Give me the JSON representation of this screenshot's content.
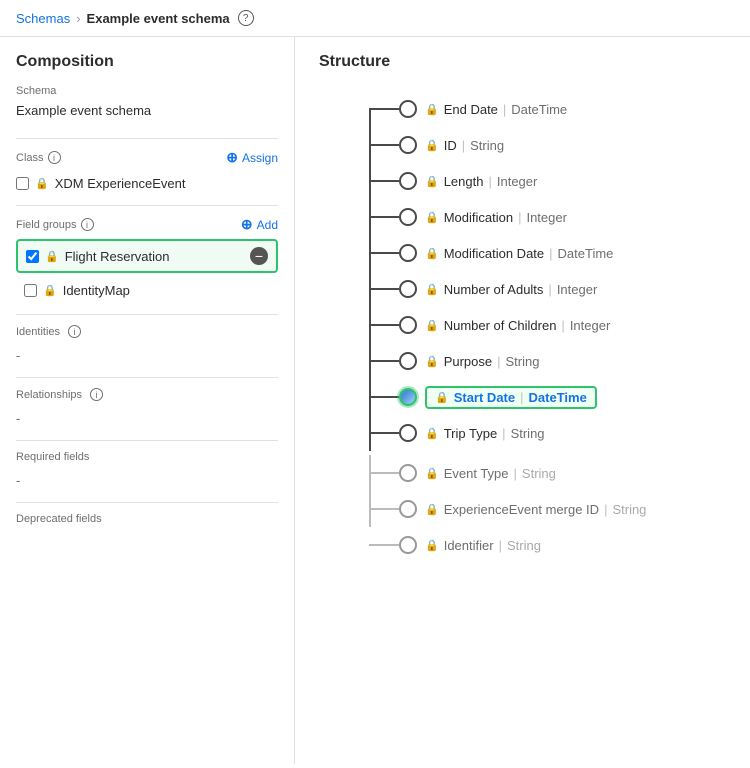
{
  "topbar": {
    "schemas_label": "Schemas",
    "separator": "›",
    "current_page": "Example event schema",
    "help_label": "?"
  },
  "left_panel": {
    "composition_title": "Composition",
    "schema_label": "Schema",
    "schema_value": "Example event schema",
    "class_label": "Class",
    "class_help": "i",
    "assign_label": "Assign",
    "class_item": "XDM ExperienceEvent",
    "field_groups_label": "Field groups",
    "field_groups_help": "i",
    "add_label": "Add",
    "field_groups": [
      {
        "name": "Flight Reservation",
        "highlighted": true
      },
      {
        "name": "IdentityMap",
        "highlighted": false
      }
    ],
    "identities_label": "Identities",
    "identities_help": "i",
    "identities_value": "-",
    "relationships_label": "Relationships",
    "relationships_help": "i",
    "relationships_value": "-",
    "required_fields_label": "Required fields",
    "required_fields_value": "-",
    "deprecated_fields_label": "Deprecated fields"
  },
  "right_panel": {
    "structure_title": "Structure",
    "nodes": [
      {
        "name": "End Date",
        "type": "DateTime",
        "highlighted": false
      },
      {
        "name": "ID",
        "type": "String",
        "highlighted": false
      },
      {
        "name": "Length",
        "type": "Integer",
        "highlighted": false
      },
      {
        "name": "Modification",
        "type": "Integer",
        "highlighted": false
      },
      {
        "name": "Modification Date",
        "type": "DateTime",
        "highlighted": false
      },
      {
        "name": "Number of Adults",
        "type": "Integer",
        "highlighted": false
      },
      {
        "name": "Number of Children",
        "type": "Integer",
        "highlighted": false
      },
      {
        "name": "Purpose",
        "type": "String",
        "highlighted": false
      },
      {
        "name": "Start Date",
        "type": "DateTime",
        "highlighted": true,
        "blue_circle": true
      },
      {
        "name": "Trip Type",
        "type": "String",
        "highlighted": false
      }
    ],
    "sub_nodes": [
      {
        "name": "Event Type",
        "type": "String",
        "locked": true
      },
      {
        "name": "ExperienceEvent merge ID",
        "type": "String",
        "locked": true
      },
      {
        "name": "Identifier",
        "type": "String",
        "locked": true
      }
    ]
  }
}
